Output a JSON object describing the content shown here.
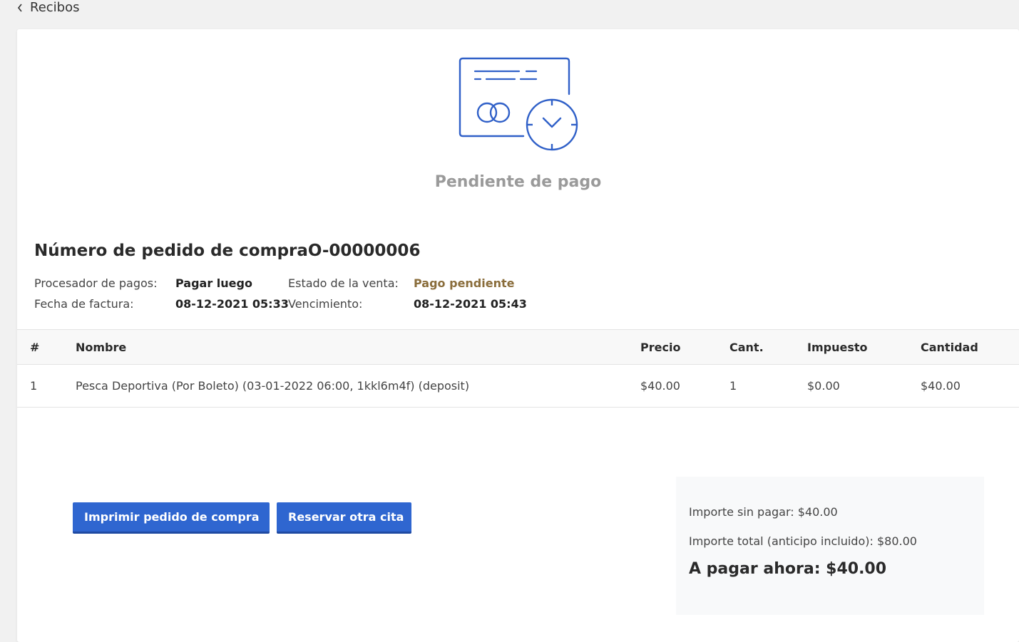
{
  "nav": {
    "back_label": "Recibos"
  },
  "status": {
    "title": "Pendiente de pago",
    "icon": "card-clock-icon",
    "icon_color": "#3060c8"
  },
  "order": {
    "title": "Número de pedido de compraO-00000006",
    "payment_processor_label": "Procesador de pagos:",
    "payment_processor_value": "Pagar luego",
    "invoice_date_label": "Fecha de factura:",
    "invoice_date_value": "08-12-2021 05:33",
    "sale_status_label": "Estado de la venta:",
    "sale_status_value": "Pago pendiente",
    "due_label": "Vencimiento:",
    "due_value": "08-12-2021 05:43",
    "sale_status_color": "#8a6d3b"
  },
  "table": {
    "headers": {
      "num": "#",
      "name": "Nombre",
      "price": "Precio",
      "qty": "Cant.",
      "tax": "Impuesto",
      "amount": "Cantidad"
    },
    "rows": [
      {
        "num": "1",
        "name": "Pesca Deportiva (Por Boleto) (03-01-2022 06:00, 1kkl6m4f) (deposit)",
        "price": "$40.00",
        "qty": "1",
        "tax": "$0.00",
        "amount": "$40.00"
      }
    ]
  },
  "actions": {
    "print_label": "Imprimir pedido de compra",
    "book_label": "Reservar otra cita",
    "button_color": "#2f66d0"
  },
  "summary": {
    "unpaid": "Importe sin pagar: $40.00",
    "total": "Importe total (anticipo incluido): $80.00",
    "pay_now": "A pagar ahora: $40.00"
  }
}
